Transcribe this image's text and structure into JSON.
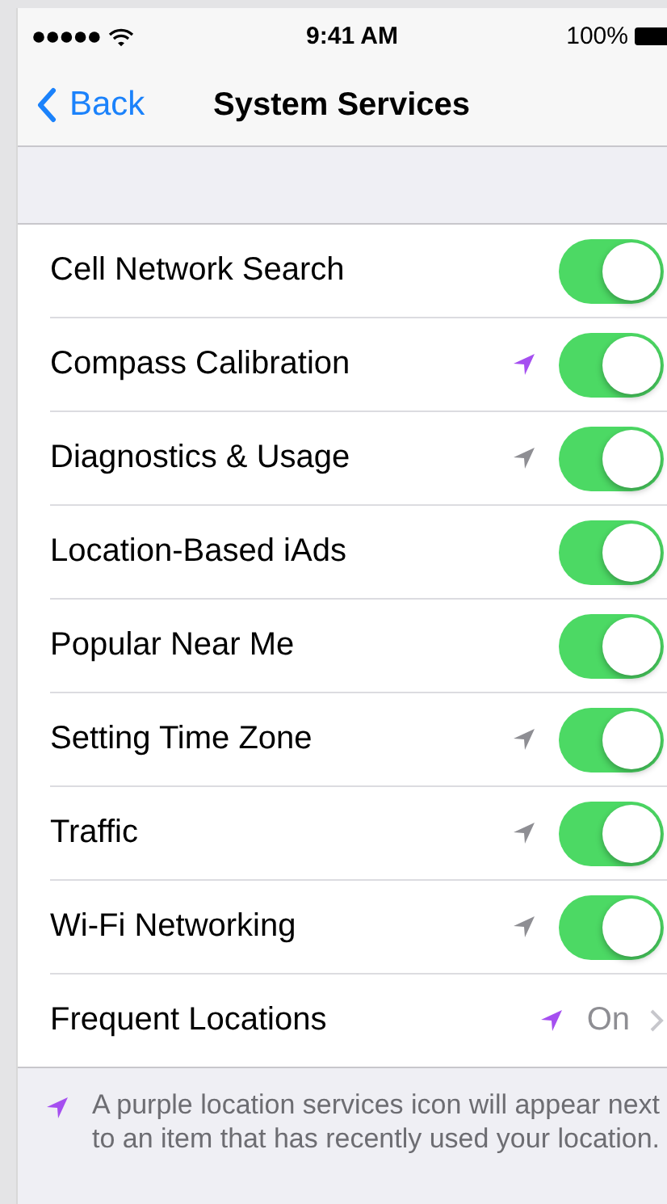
{
  "status_bar": {
    "time": "9:41 AM",
    "battery": "100%"
  },
  "nav": {
    "back": "Back",
    "title": "System Services"
  },
  "rows": [
    {
      "kind": "toggle",
      "label": "Cell Network Search",
      "on": true
    },
    {
      "kind": "toggle",
      "label": "Compass Calibration",
      "on": true,
      "color": "#a54ff0"
    },
    {
      "kind": "toggle",
      "label": "Diagnostics & Usage",
      "on": true,
      "color": "#8e8e93"
    },
    {
      "kind": "toggle",
      "label": "Location-Based iAds",
      "on": true
    },
    {
      "kind": "toggle",
      "label": "Popular Near Me",
      "on": true
    },
    {
      "kind": "toggle",
      "label": "Setting Time Zone",
      "on": true,
      "color": "#8e8e93"
    },
    {
      "kind": "toggle",
      "label": "Traffic",
      "on": true,
      "color": "#8e8e93"
    },
    {
      "kind": "toggle",
      "label": "Wi-Fi Networking",
      "on": true,
      "color": "#8e8e93"
    },
    {
      "kind": "disclosure",
      "label": "Frequent Locations",
      "value": "On",
      "color": "#a54ff0"
    }
  ],
  "footer": {
    "text": "A purple location services icon will appear next to an item that has recently used your location.",
    "color": "#a54ff0"
  }
}
